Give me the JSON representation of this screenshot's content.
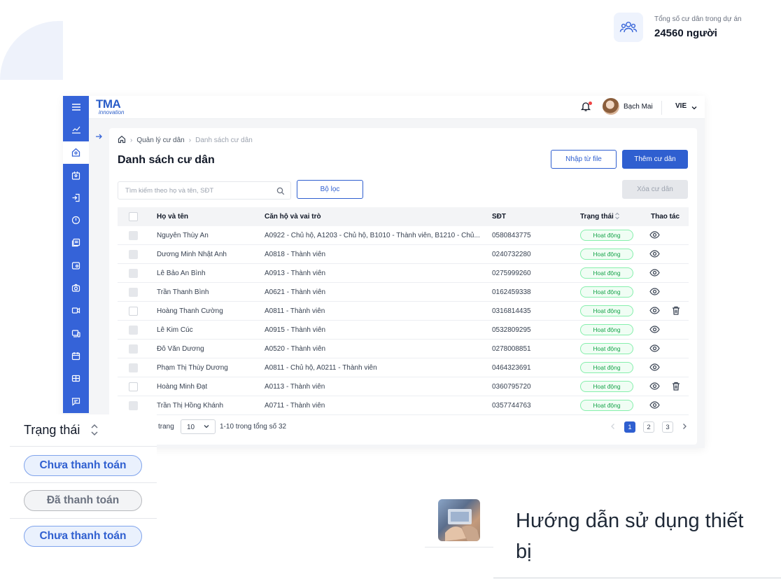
{
  "stat": {
    "label": "Tổng số cư dân trong dự án",
    "value": "24560 người",
    "icon": "users-icon"
  },
  "header": {
    "logo_text": "TMA",
    "logo_sub": "innovation",
    "user_name": "Bạch Mai",
    "language": "VIE"
  },
  "breadcrumb": {
    "parent": "Quản lý cư dân",
    "current": "Danh sách cư dân"
  },
  "page": {
    "title": "Danh sách cư dân",
    "import_label": "Nhập từ file",
    "add_label": "Thêm cư dân",
    "delete_label": "Xóa cư dân",
    "filter_label": "Bộ lọc",
    "search_placeholder": "Tìm kiếm theo họ và tên, SĐT"
  },
  "table": {
    "columns": {
      "name": "Họ và tên",
      "apartment": "Căn hộ và vai trò",
      "phone": "SĐT",
      "status": "Trạng thái",
      "actions": "Thao tác"
    },
    "rows": [
      {
        "name": "Nguyễn Thùy An",
        "apartment": "A0922 - Chủ hộ, A1203 - Chủ hộ, B1010 - Thành viên, B1210 - Chủ...",
        "phone": "0580843775",
        "status": "Hoạt động",
        "deletable": false
      },
      {
        "name": "Dương Minh Nhật Anh",
        "apartment": "A0818 - Thành viên",
        "phone": "0240732280",
        "status": "Hoạt động",
        "deletable": false
      },
      {
        "name": "Lê Bảo An Bình",
        "apartment": "A0913 - Thành viên",
        "phone": "0275999260",
        "status": "Hoạt động",
        "deletable": false
      },
      {
        "name": "Trần Thanh Bình",
        "apartment": "A0621 - Thành viên",
        "phone": "0162459338",
        "status": "Hoạt động",
        "deletable": false
      },
      {
        "name": "Hoàng Thanh Cường",
        "apartment": "A0811 - Thành viên",
        "phone": "0316814435",
        "status": "Hoạt động",
        "deletable": true
      },
      {
        "name": "Lê Kim Cúc",
        "apartment": "A0915 - Thành viên",
        "phone": "0532809295",
        "status": "Hoạt động",
        "deletable": false
      },
      {
        "name": "Đỗ Văn Dương",
        "apartment": "A0520 - Thành viên",
        "phone": "0278008851",
        "status": "Hoạt động",
        "deletable": false
      },
      {
        "name": "Phạm Thị Thùy Dương",
        "apartment": "A0811 - Chủ hộ, A0211 - Thành viên",
        "phone": "0464323691",
        "status": "Hoạt động",
        "deletable": false
      },
      {
        "name": "Hoàng Minh Đạt",
        "apartment": "A0113 - Thành viên",
        "phone": "0360795720",
        "status": "Hoạt động",
        "deletable": true
      },
      {
        "name": "Trần Thị Hồng Khánh",
        "apartment": "A0711 - Thành viên",
        "phone": "0357744763",
        "status": "Hoạt động",
        "deletable": false
      }
    ]
  },
  "pagination": {
    "per_page_label": "trang",
    "page_size": "10",
    "range_text": "1-10 trong tổng số 32",
    "pages": [
      "1",
      "2",
      "3"
    ],
    "current_page": "1"
  },
  "status_filter": {
    "title": "Trạng thái",
    "options": [
      "Chưa thanh toán",
      "Đã thanh toán",
      "Chưa thanh toán"
    ]
  },
  "guide": {
    "text": "Hướng dẫn sử dụng thiết bị"
  },
  "colors": {
    "primary": "#2f5fd0",
    "sidebar": "#3563d8",
    "success": "#16a34a"
  }
}
